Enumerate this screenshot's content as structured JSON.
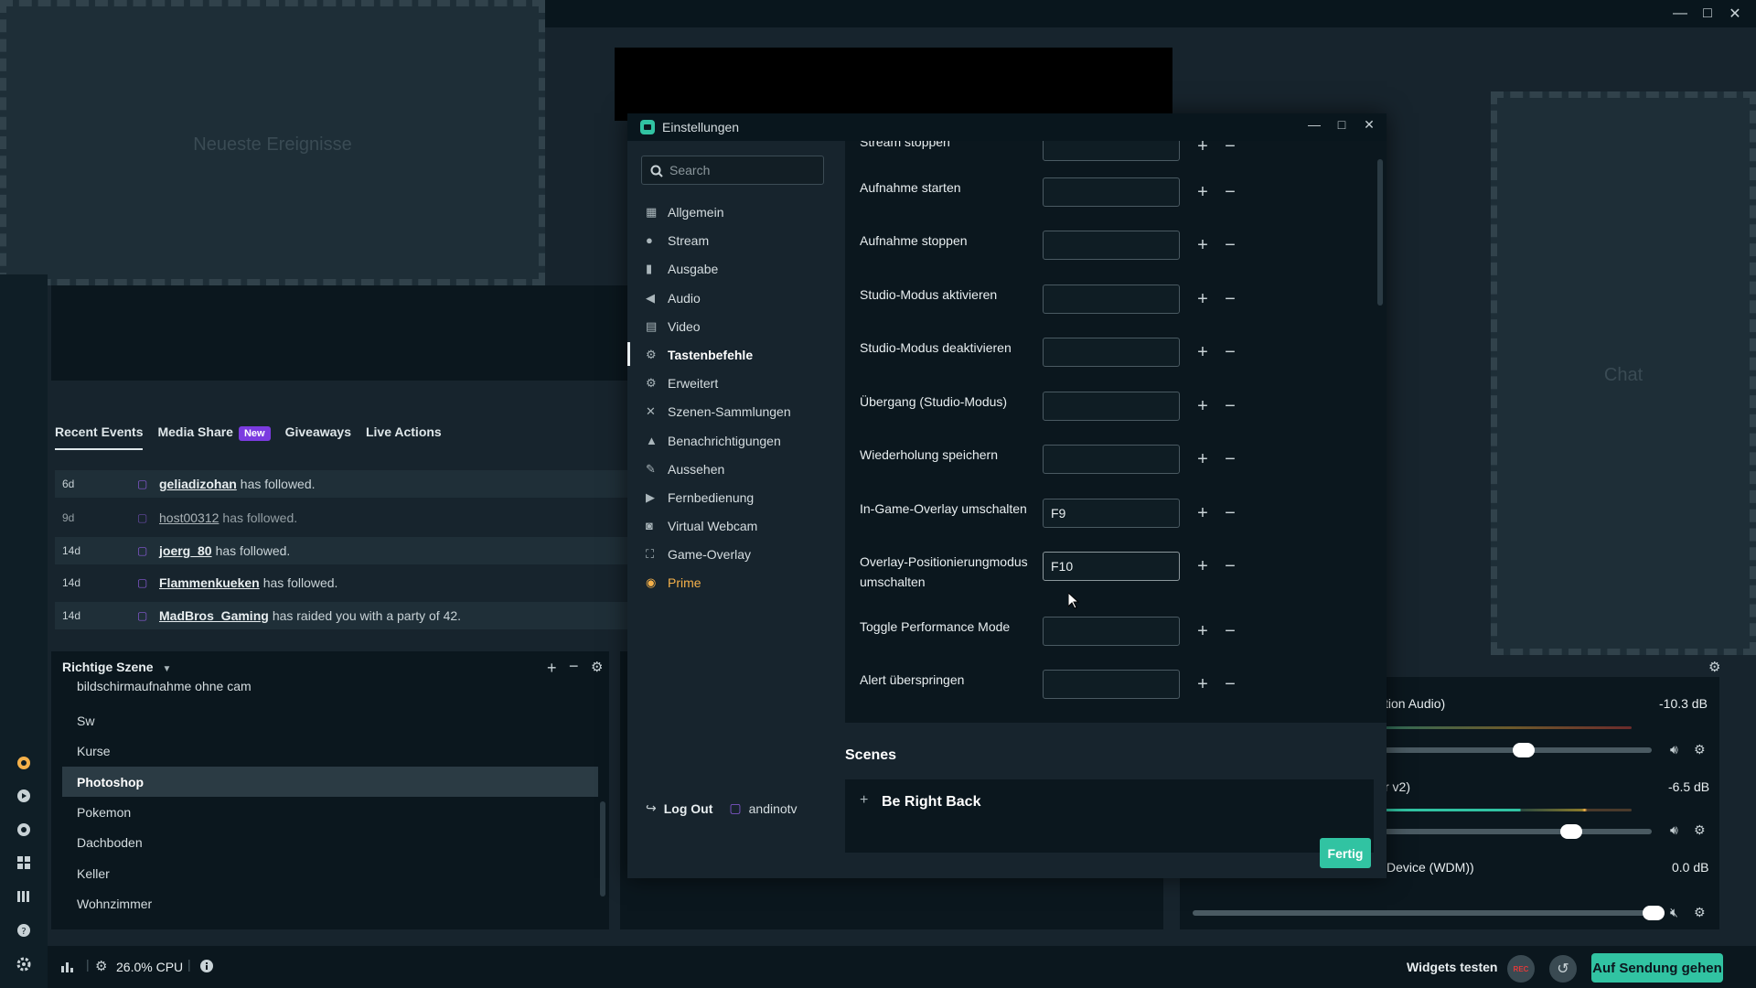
{
  "app": {
    "window_controls": [
      "—",
      "□",
      "✕"
    ]
  },
  "widgets": {
    "recent_events_placeholder": "Neueste Ereignisse",
    "chat_placeholder": "Chat"
  },
  "events": {
    "tabs": [
      {
        "label": "Recent Events"
      },
      {
        "label": "Media Share",
        "badge": "New"
      },
      {
        "label": "Giveaways"
      },
      {
        "label": "Live Actions"
      }
    ],
    "rows": [
      {
        "time": "6d",
        "name": "geliadizohan",
        "text": "has followed."
      },
      {
        "time": "9d",
        "name": "host00312",
        "text": "has followed."
      },
      {
        "time": "14d",
        "name": "joerg_80",
        "text": "has followed."
      },
      {
        "time": "14d",
        "name": "Flammenkueken",
        "text": "has followed."
      },
      {
        "time": "14d",
        "name": "MadBros_Gaming",
        "text": "has raided you with a party of 42."
      }
    ]
  },
  "scenes": {
    "header": "Richtige Szene",
    "items": [
      "bildschirmaufnahme ohne cam",
      "Sw",
      "Kurse",
      "Photoshop",
      "Pokemon",
      "Dachboden",
      "Keller",
      "Wohnzimmer"
    ],
    "selected": "Photoshop"
  },
  "mixer": {
    "tracks": [
      {
        "label": "tion Audio)",
        "db": "-10.3 dB",
        "level": 0.62
      },
      {
        "label": "r v2)",
        "db": "-6.5 dB",
        "level": 0.74
      },
      {
        "label": "Device (WDM))",
        "db": "0.0 dB",
        "level": 1.0
      }
    ]
  },
  "bottombar": {
    "cpu": "26.0% CPU",
    "widgets_test": "Widgets testen",
    "rec": "REC",
    "go_live": "Auf Sendung gehen"
  },
  "settings": {
    "title": "Einstellungen",
    "search_placeholder": "Search",
    "nav": [
      {
        "label": "Allgemein",
        "icon": "grid-icon"
      },
      {
        "label": "Stream",
        "icon": "globe-icon"
      },
      {
        "label": "Ausgabe",
        "icon": "database-icon"
      },
      {
        "label": "Audio",
        "icon": "speaker-icon"
      },
      {
        "label": "Video",
        "icon": "film-icon"
      },
      {
        "label": "Tastenbefehle",
        "icon": "gear-icon"
      },
      {
        "label": "Erweitert",
        "icon": "cogs-icon"
      },
      {
        "label": "Szenen-Sammlungen",
        "icon": "tools-icon"
      },
      {
        "label": "Benachrichtigungen",
        "icon": "bell-icon"
      },
      {
        "label": "Aussehen",
        "icon": "brush-icon"
      },
      {
        "label": "Fernbedienung",
        "icon": "play-circle-icon"
      },
      {
        "label": "Virtual Webcam",
        "icon": "camera-icon"
      },
      {
        "label": "Game-Overlay",
        "icon": "expand-icon"
      },
      {
        "label": "Prime",
        "icon": "prime-icon"
      }
    ],
    "active_nav": "Tastenbefehle",
    "hotkeys": [
      {
        "label": "Stream stoppen",
        "value": ""
      },
      {
        "label": "Aufnahme starten",
        "value": ""
      },
      {
        "label": "Aufnahme stoppen",
        "value": ""
      },
      {
        "label": "Studio-Modus aktivieren",
        "value": ""
      },
      {
        "label": "Studio-Modus deaktivieren",
        "value": ""
      },
      {
        "label": "Übergang (Studio-Modus)",
        "value": ""
      },
      {
        "label": "Wiederholung speichern",
        "value": ""
      },
      {
        "label": "In-Game-Overlay umschalten",
        "value": "F9"
      },
      {
        "label": "Overlay-Positionierungmodus umschalten",
        "value": "F10"
      },
      {
        "label": "Toggle Performance Mode",
        "value": ""
      },
      {
        "label": "Alert überspringen",
        "value": ""
      }
    ],
    "scenes_section": "Scenes",
    "scene_entry": "Be Right Back",
    "logout": "Log Out",
    "username": "andinotv",
    "done_button": "Fertig"
  }
}
